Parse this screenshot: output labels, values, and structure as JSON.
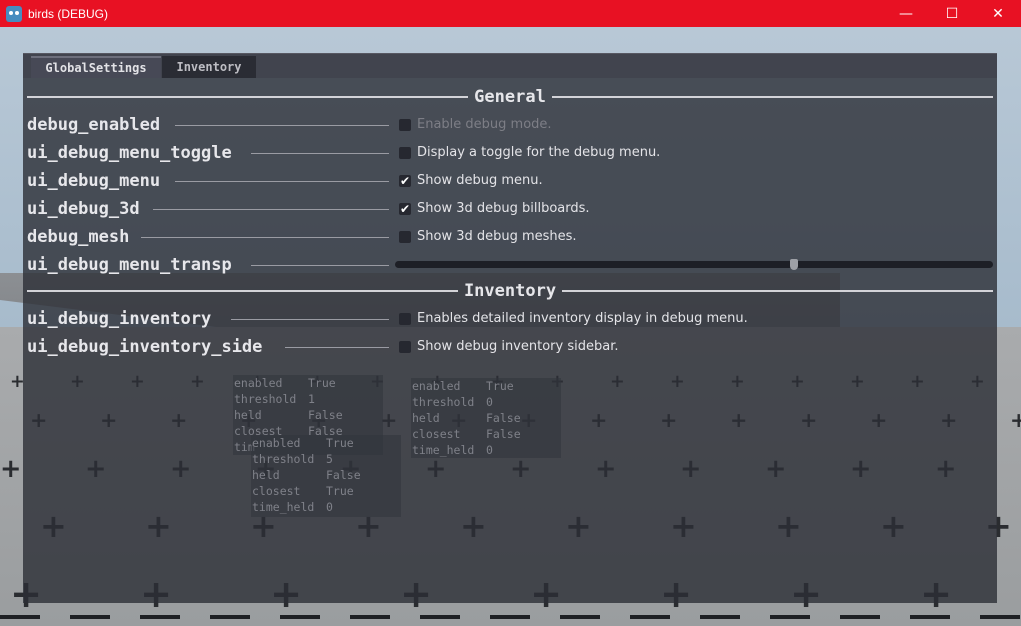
{
  "window": {
    "title": "birds (DEBUG)",
    "controls": {
      "minimize": "—",
      "maximize": "☐",
      "close": "✕"
    },
    "accent_color": "#e81123"
  },
  "tabs": [
    {
      "label": "GlobalSettings",
      "active": true
    },
    {
      "label": "Inventory",
      "active": false
    }
  ],
  "sections": {
    "general": "General",
    "inventory": "Inventory"
  },
  "settings": [
    {
      "name": "debug_enabled",
      "checked": false,
      "check_glyph": "",
      "description": "Enable debug mode.",
      "disabled": true
    },
    {
      "name": "ui_debug_menu_toggle",
      "checked": false,
      "check_glyph": "",
      "description": "Display a toggle for the debug menu.",
      "disabled": false
    },
    {
      "name": "ui_debug_menu",
      "checked": true,
      "check_glyph": "✔",
      "description": "Show debug menu.",
      "disabled": false
    },
    {
      "name": "ui_debug_3d",
      "checked": true,
      "check_glyph": "✔",
      "description": "Show 3d debug billboards.",
      "disabled": false
    },
    {
      "name": "debug_mesh",
      "checked": false,
      "check_glyph": "",
      "description": "Show 3d debug meshes.",
      "disabled": false
    },
    {
      "name": "ui_debug_menu_transp",
      "slider_value": 0.67
    },
    {
      "name": "ui_debug_inventory",
      "checked": false,
      "check_glyph": "",
      "description": "Enables detailed inventory display in debug menu.",
      "disabled": false
    },
    {
      "name": "ui_debug_inventory_side",
      "checked": false,
      "check_glyph": "",
      "description": "Show debug inventory sidebar.",
      "disabled": false
    }
  ],
  "inventory_boxes": [
    {
      "rows": [
        [
          "enabled",
          "True"
        ],
        [
          "threshold",
          "1"
        ],
        [
          "held",
          "False"
        ],
        [
          "closest",
          "False"
        ],
        [
          "tim",
          ""
        ]
      ]
    },
    {
      "rows": [
        [
          "enabled",
          "True"
        ],
        [
          "threshold",
          "5"
        ],
        [
          "held",
          "False"
        ],
        [
          "closest",
          "True"
        ],
        [
          "time_held",
          "0"
        ]
      ]
    },
    {
      "rows": [
        [
          "enabled",
          "True"
        ],
        [
          "threshold",
          "0"
        ],
        [
          "held",
          "False"
        ],
        [
          "closest",
          "False"
        ],
        [
          "time_held",
          "0"
        ]
      ]
    }
  ],
  "scene": {
    "floor_symbol": "+"
  }
}
